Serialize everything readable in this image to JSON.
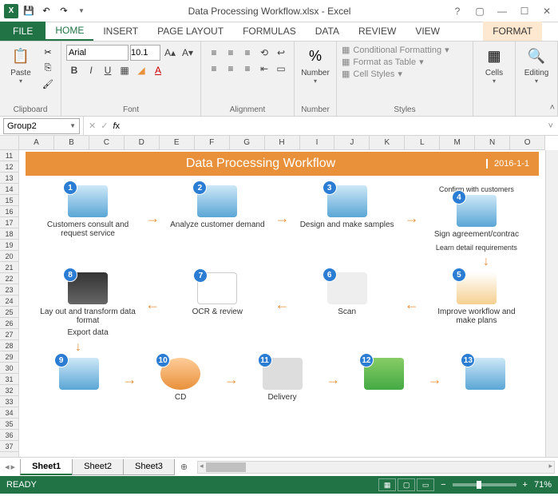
{
  "app": {
    "title": "Data Processing Workflow.xlsx - Excel"
  },
  "tabs": {
    "file": "FILE",
    "list": [
      "HOME",
      "INSERT",
      "PAGE LAYOUT",
      "FORMULAS",
      "DATA",
      "REVIEW",
      "VIEW"
    ],
    "format": "FORMAT",
    "active": "HOME"
  },
  "ribbon": {
    "clipboard": {
      "label": "Clipboard",
      "paste": "Paste"
    },
    "font": {
      "label": "Font",
      "name": "Arial",
      "size": "10.1"
    },
    "alignment": {
      "label": "Alignment"
    },
    "number": {
      "label": "Number",
      "btn": "Number",
      "pct": "%"
    },
    "styles": {
      "label": "Styles",
      "cond": "Conditional Formatting",
      "table": "Format as Table",
      "cell": "Cell Styles"
    },
    "cells": {
      "label": "Cells",
      "btn": "Cells"
    },
    "editing": {
      "label": "Editing",
      "btn": "Editing"
    }
  },
  "namebox": "Group2",
  "columns": [
    "A",
    "B",
    "C",
    "D",
    "E",
    "F",
    "G",
    "H",
    "I",
    "J",
    "K",
    "L",
    "M",
    "N",
    "O"
  ],
  "rows_start": 11,
  "rows_end": 37,
  "workflow": {
    "title": "Data Processing Workflow",
    "date": "2016-1-1",
    "nodes": {
      "n1": "Customers consult and request service",
      "n2": "Analyze customer demand",
      "n3": "Design and make samples",
      "n3b": "Confirm with customers",
      "n4": "Sign agreement/contrac",
      "n4b": "Learn detail requirements",
      "n5": "Improve workflow and make plans",
      "n6": "Scan",
      "n7": "OCR & review",
      "n8": "Lay out and transform data  format",
      "n8b": "Export data",
      "n9": "",
      "n10": "CD",
      "n11": "Delivery",
      "n12": "",
      "n13": ""
    }
  },
  "sheets": [
    "Sheet1",
    "Sheet2",
    "Sheet3"
  ],
  "status": {
    "ready": "READY",
    "zoom": "71%"
  }
}
